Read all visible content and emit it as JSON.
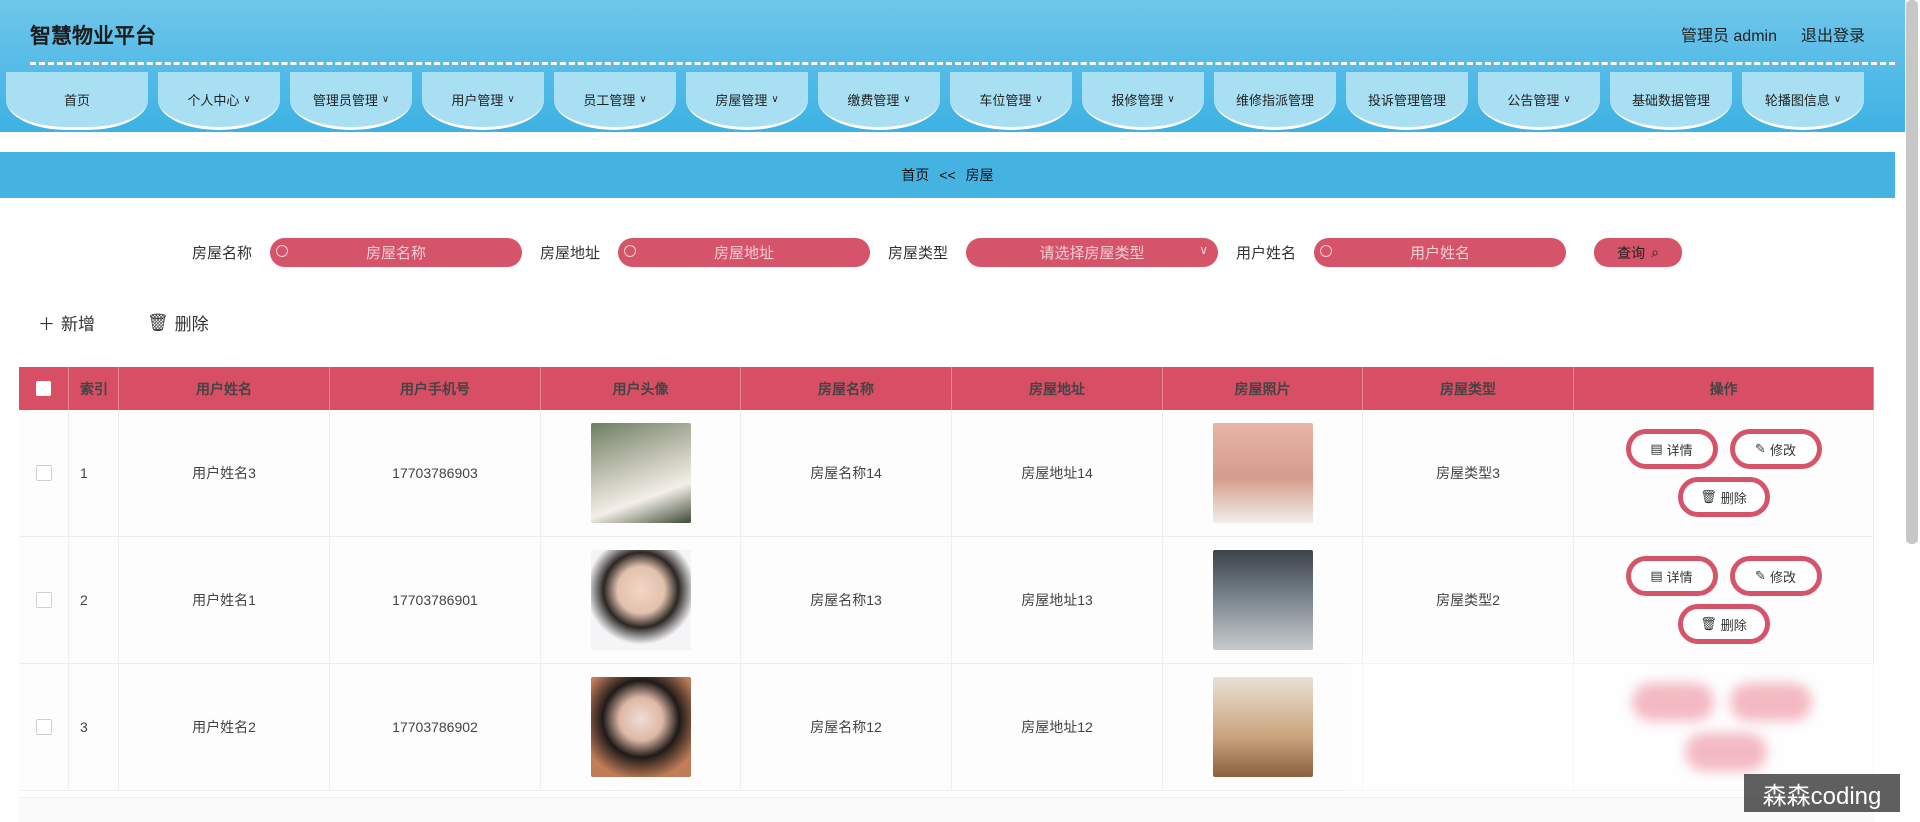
{
  "app": {
    "title": "智慧物业平台",
    "user": "管理员 admin",
    "logout": "退出登录"
  },
  "nav": [
    {
      "label": "首页",
      "dropdown": false
    },
    {
      "label": "个人中心",
      "dropdown": true
    },
    {
      "label": "管理员管理",
      "dropdown": true
    },
    {
      "label": "用户管理",
      "dropdown": true
    },
    {
      "label": "员工管理",
      "dropdown": true
    },
    {
      "label": "房屋管理",
      "dropdown": true
    },
    {
      "label": "缴费管理",
      "dropdown": true
    },
    {
      "label": "车位管理",
      "dropdown": true
    },
    {
      "label": "报修管理",
      "dropdown": true
    },
    {
      "label": "维修指派管理",
      "dropdown": false
    },
    {
      "label": "投诉管理管理",
      "dropdown": false
    },
    {
      "label": "公告管理",
      "dropdown": true
    },
    {
      "label": "基础数据管理",
      "dropdown": false
    },
    {
      "label": "轮播图信息",
      "dropdown": true
    }
  ],
  "breadcrumb": {
    "home": "首页",
    "sep": "<<",
    "current": "房屋"
  },
  "search": {
    "name_label": "房屋名称",
    "name_placeholder": "房屋名称",
    "addr_label": "房屋地址",
    "addr_placeholder": "房屋地址",
    "type_label": "房屋类型",
    "type_placeholder": "请选择房屋类型",
    "user_label": "用户姓名",
    "user_placeholder": "用户姓名",
    "query": "查询"
  },
  "actions": {
    "add": "新增",
    "delete": "删除"
  },
  "table": {
    "headers": [
      "索引",
      "用户姓名",
      "用户手机号",
      "用户头像",
      "房屋名称",
      "房屋地址",
      "房屋照片",
      "房屋类型",
      "操作"
    ],
    "rows": [
      {
        "index": "1",
        "user": "用户姓名3",
        "phone": "17703786903",
        "house": "房屋名称14",
        "addr": "房屋地址14",
        "type": "房屋类型3"
      },
      {
        "index": "2",
        "user": "用户姓名1",
        "phone": "17703786901",
        "house": "房屋名称13",
        "addr": "房屋地址13",
        "type": "房屋类型2"
      },
      {
        "index": "3",
        "user": "用户姓名2",
        "phone": "17703786902",
        "house": "房屋名称12",
        "addr": "房屋地址12",
        "type": ""
      }
    ],
    "btn_detail": "详情",
    "btn_edit": "修改",
    "btn_delete": "删除"
  },
  "watermark": "森森coding",
  "colors": {
    "primary": "#d5546a",
    "nav_bg": "#45b3e1"
  }
}
